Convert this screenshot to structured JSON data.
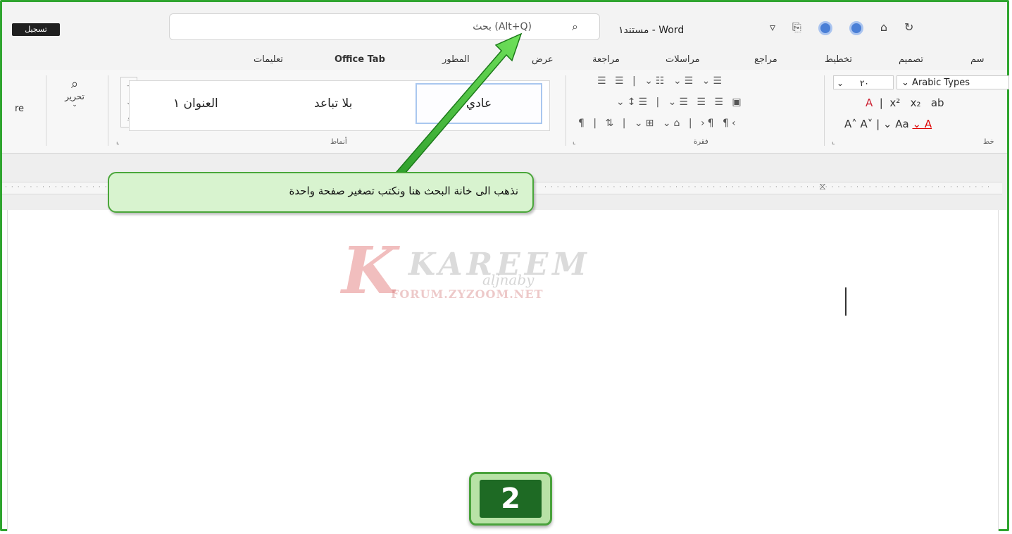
{
  "titlebar": {
    "signin_label": "تسجيل",
    "search_placeholder": "بحث (Alt+Q)",
    "doc_title": "مستند١ - Word"
  },
  "tabs": [
    {
      "label": "تعليمات"
    },
    {
      "label": "Office Tab"
    },
    {
      "label": "المطور"
    },
    {
      "label": "عرض"
    },
    {
      "label": "مراجعة"
    },
    {
      "label": "مراسلات"
    },
    {
      "label": "مراجع"
    },
    {
      "label": "تخطيط"
    },
    {
      "label": "تصميم"
    },
    {
      "label": "سم"
    }
  ],
  "ribbon": {
    "share_label": "re",
    "editing_label": "تحرير",
    "styles": [
      {
        "label": "عادي",
        "selected": true
      },
      {
        "label": "بلا تباعد",
        "selected": false
      },
      {
        "label": "العنوان ١",
        "selected": false
      }
    ],
    "groups": {
      "styles": "أنماط",
      "paragraph": "فقرة",
      "font": "خط"
    },
    "font_name": "Arabic Types",
    "font_size": "٢٠"
  },
  "callout": {
    "text": "نذهب الى خانة البحث هنا ونكتب تصغير صفحة واحدة"
  },
  "watermark": {
    "brand": "KAREEM",
    "script": "aljnaby",
    "url": "FORUM.ZYZOOM.NET"
  },
  "step_badge": "2",
  "colors": {
    "frame_green": "#2fa52f",
    "callout_fill": "#d8f3cf",
    "badge_fill": "#1e6a24",
    "arrow_green": "#3db83a"
  }
}
